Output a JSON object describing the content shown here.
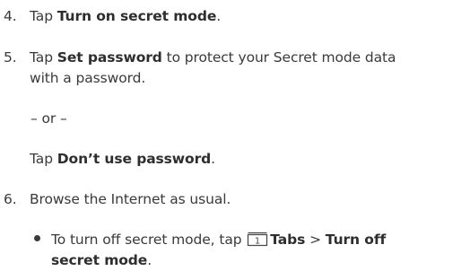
{
  "steps": [
    {
      "number": "4.",
      "pre": "Tap ",
      "bold": "Turn on secret mode",
      "post": "."
    },
    {
      "number": "5.",
      "pre": "Tap ",
      "bold": "Set password",
      "post": " to protect your Secret mode data",
      "line2": "with a password."
    },
    {
      "or": "– or –"
    },
    {
      "pre": "Tap ",
      "bold": "Don’t use password",
      "post": "."
    },
    {
      "number": "6.",
      "text": "Browse the Internet as usual."
    }
  ],
  "bullet": {
    "pre": "To turn off secret mode, tap ",
    "icon": "tabs-icon",
    "icon_number": "1",
    "bold1": "Tabs",
    "separator": " > ",
    "bold2": "Turn off",
    "bold3": "secret mode",
    "post": "."
  }
}
